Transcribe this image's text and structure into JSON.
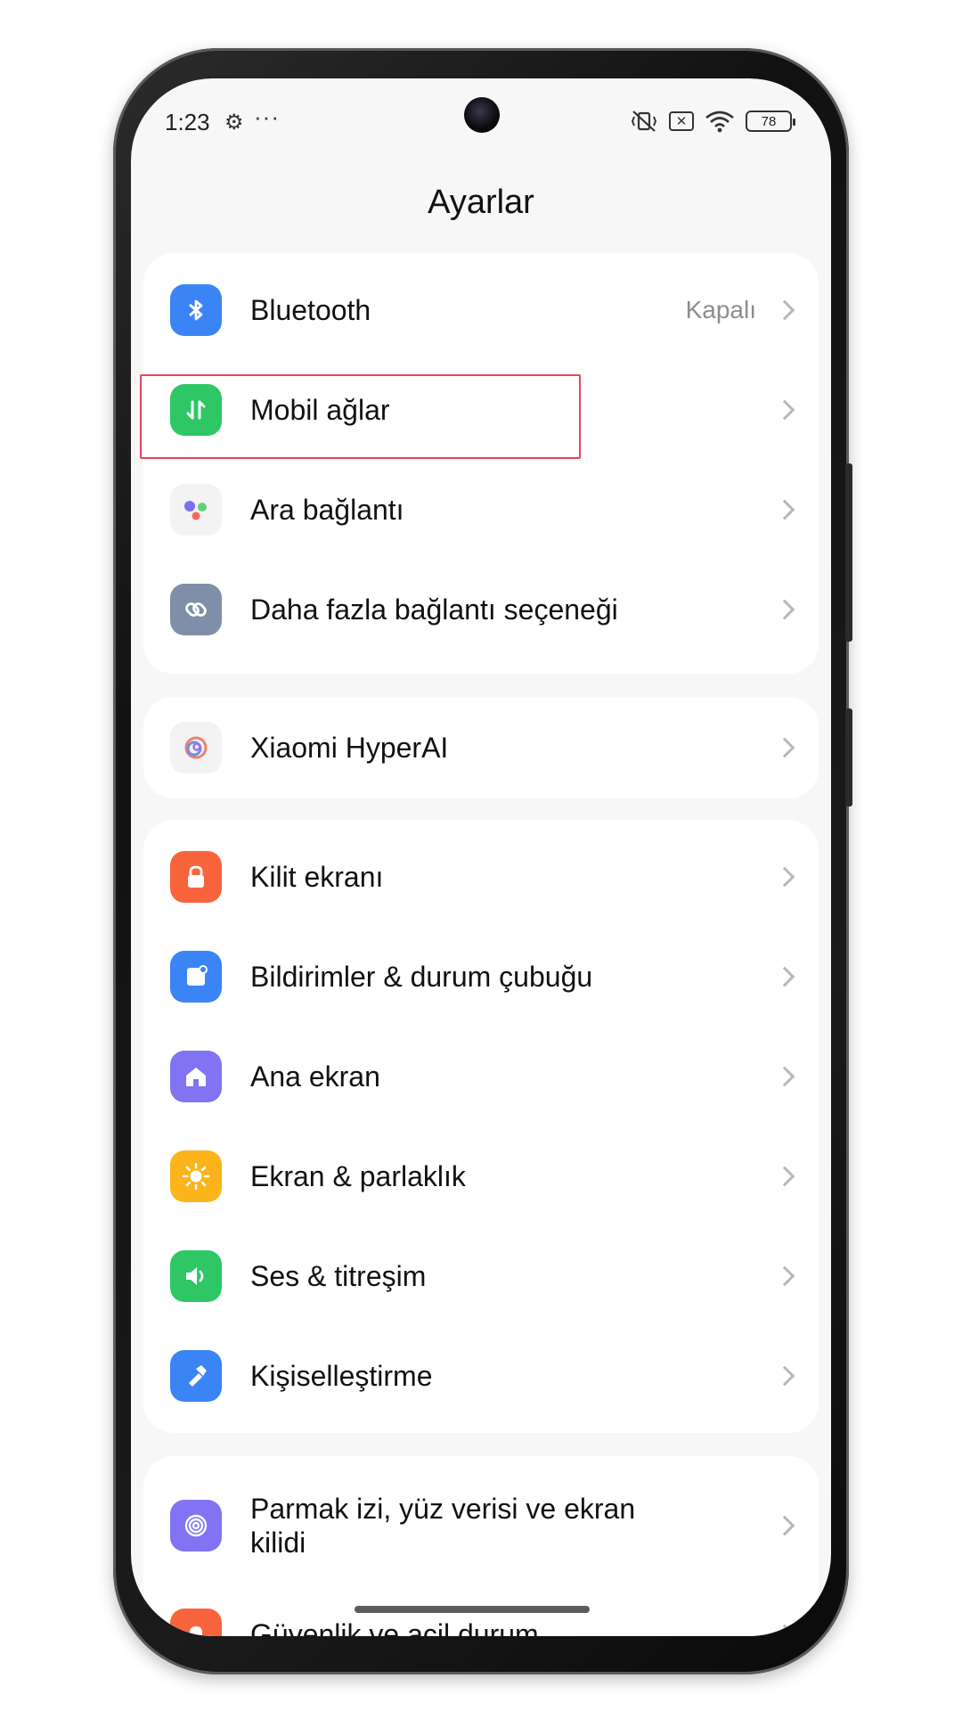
{
  "status_bar": {
    "time": "1:23",
    "settings_icon": "⚙",
    "more": "···",
    "battery": "78"
  },
  "header": {
    "title": "Ayarlar"
  },
  "groups": [
    [
      {
        "label": "Bluetooth",
        "value": "Kapalı",
        "icon": "bluetooth-icon",
        "color": "#3a84f5"
      },
      {
        "label": "Mobil ağlar",
        "icon": "mobile-data-icon",
        "color": "#2fc766"
      },
      {
        "label": "Ara bağlantı",
        "icon": "interconnect-icon",
        "color": "#f3f3f3"
      },
      {
        "label": "Daha fazla bağlantı seçeneği",
        "icon": "link-icon",
        "color": "#7f8fa8"
      }
    ],
    [
      {
        "label": "Xiaomi HyperAI",
        "icon": "hyperai-icon",
        "color": "#f3f3f3"
      }
    ],
    [
      {
        "label": "Kilit ekranı",
        "icon": "lock-icon",
        "color": "#f7643b"
      },
      {
        "label": "Bildirimler & durum çubuğu",
        "icon": "notification-icon",
        "color": "#3a84f5"
      },
      {
        "label": "Ana ekran",
        "icon": "home-icon",
        "color": "#8272f4"
      },
      {
        "label": "Ekran & parlaklık",
        "icon": "brightness-icon",
        "color": "#fbb41b"
      },
      {
        "label": "Ses & titreşim",
        "icon": "sound-icon",
        "color": "#2fc766"
      },
      {
        "label": "Kişiselleştirme",
        "icon": "personalization-icon",
        "color": "#3a84f5"
      }
    ],
    [
      {
        "label": "Parmak izi, yüz verisi ve ekran kilidi",
        "icon": "fingerprint-icon",
        "color": "#8272f4"
      },
      {
        "label": "Güvenlik ve acil durum",
        "icon": "safety-icon",
        "color": "#f7643b"
      }
    ]
  ],
  "highlight": {
    "color": "#e8455a",
    "target": "Mobil ağlar"
  }
}
